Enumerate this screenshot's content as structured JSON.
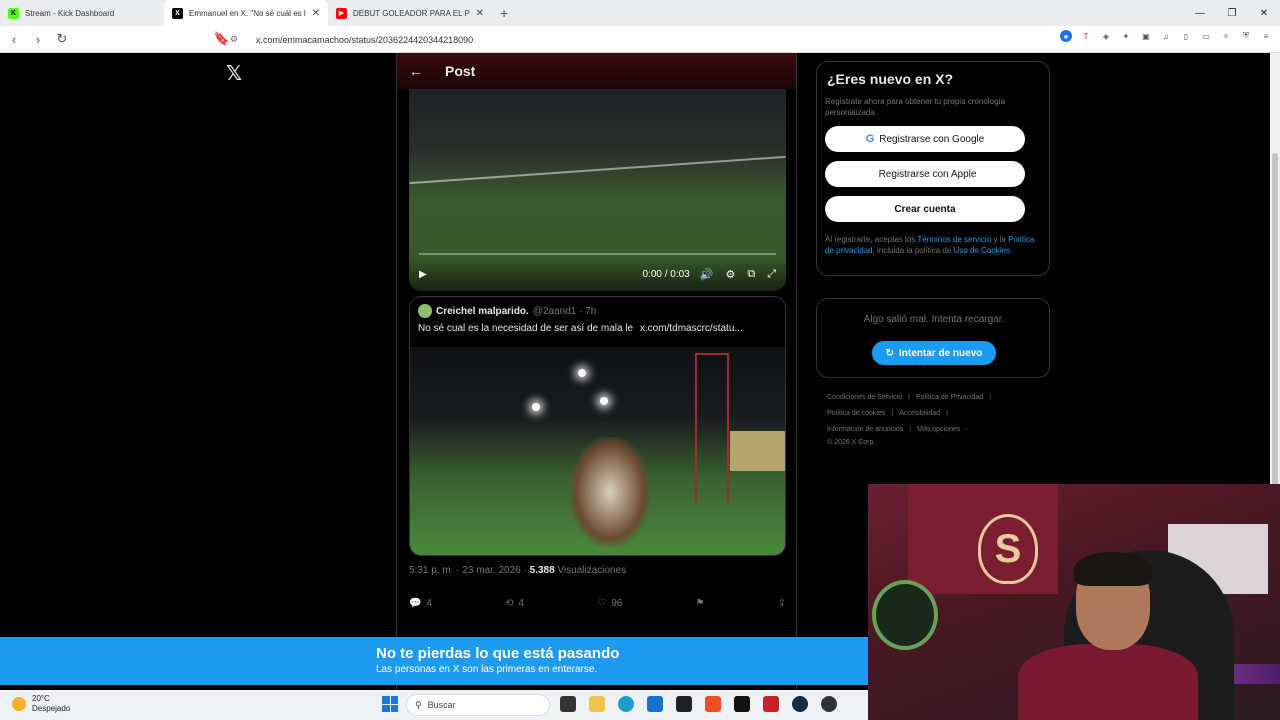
{
  "browser": {
    "tabs": [
      {
        "title": "Stream - Kick Dashboard",
        "favicon": "K",
        "color": "#53fc18"
      },
      {
        "title": "Emmanuel en X: \"No sé cuál es l",
        "favicon": "X",
        "color": "#000000"
      },
      {
        "title": "DEBUT GOLEADOR PARA EL PIBE AR",
        "favicon": "▶",
        "color": "#ff0000"
      }
    ],
    "url": "x.com/emmacamachoo/status/2036224420344218090"
  },
  "post_header": {
    "title": "Post",
    "back_icon": "←"
  },
  "video": {
    "time": "0:00 / 0:03"
  },
  "quote": {
    "name": "Creichel malparido.",
    "handle": "@2aand1 · 7h",
    "text": "No sé cual es la necesidad de ser así de mala le",
    "link": "x.com/tdmascrc/statu..."
  },
  "meta": {
    "date": "5:31 p. m. · 23 mar. 2026 · ",
    "views_count": "5.388",
    "views_label": " Visualizaciones"
  },
  "actions": {
    "replies": "4",
    "reposts": "4",
    "likes": "96"
  },
  "signup": {
    "title": "¿Eres nuevo en X?",
    "subtitle": "Regístrate ahora para obtener tu propia cronología personalizada.",
    "google": "Registrarse con Google",
    "apple": "Registrarse con Apple",
    "create": "Crear cuenta",
    "legal_1": "Al registrarte, aceptas los ",
    "legal_terms": "Términos de servicio",
    "legal_2": " y la ",
    "legal_privacy": "Política de privacidad",
    "legal_3": ", incluida la política de ",
    "legal_cookies": "Uso de Cookies",
    "legal_4": "."
  },
  "error": {
    "text": "Algo salió mal. Intenta recargar.",
    "retry": "Intentar de nuevo"
  },
  "footer": {
    "links": [
      "Condiciones de Servicio",
      "Política de Privacidad",
      "Política de cookies",
      "Accesibilidad",
      "Información de anuncios",
      "Más opciones ···"
    ],
    "copyright": "© 2026 X Corp."
  },
  "banner": {
    "title": "No te pierdas lo que está pasando",
    "subtitle": "Las personas en X son las primeras en enterarse."
  },
  "taskbar": {
    "temp": "20°C",
    "weather": "Despejado",
    "search": "Buscar"
  }
}
